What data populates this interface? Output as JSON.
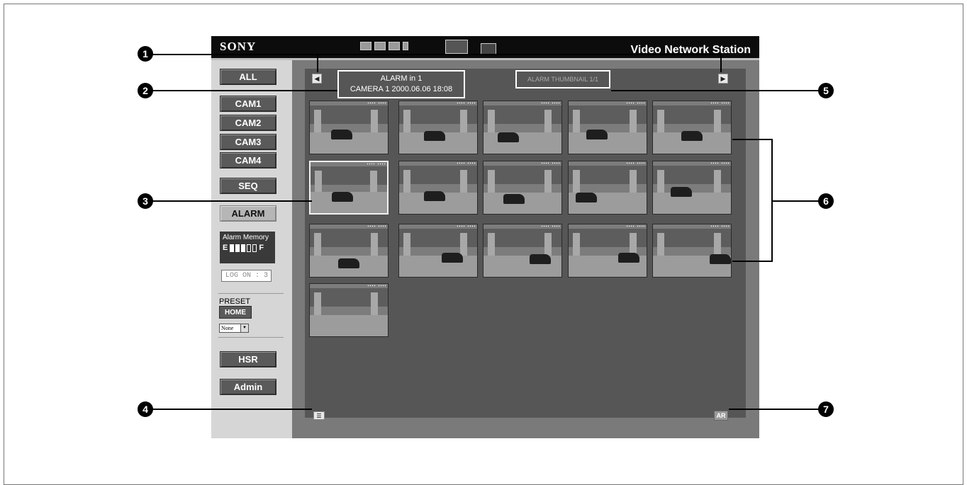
{
  "app": {
    "logo": "SONY",
    "brand": "Video Network Station"
  },
  "sidebar": {
    "buttons": [
      "ALL",
      "CAM1",
      "CAM2",
      "CAM3",
      "CAM4",
      "SEQ",
      "ALARM"
    ],
    "alarm_memory_label": "Alarm Memory",
    "alarm_memory_empty": "E",
    "alarm_memory_full": "F",
    "alarm_memory_level": 0.6,
    "logon_text": "LOG ON : 3",
    "preset_label": "PRESET",
    "home_label": "HOME",
    "preset_select_value": "None",
    "hsr_label": "HSR",
    "admin_label": "Admin"
  },
  "viewer": {
    "alarm_line1": "ALARM in 1",
    "alarm_line2": "CAMERA 1 2000.06.06 18:08",
    "thumbnail_title": "ALARM THUMBNAIL 1/1",
    "prev_icon": "left-arrow-icon",
    "next_icon": "right-arrow-icon",
    "thumbnail_count": 16,
    "list_icon": "list-icon",
    "ar_label": "AR"
  },
  "callouts": [
    "1",
    "2",
    "3",
    "4",
    "5",
    "6",
    "7"
  ]
}
